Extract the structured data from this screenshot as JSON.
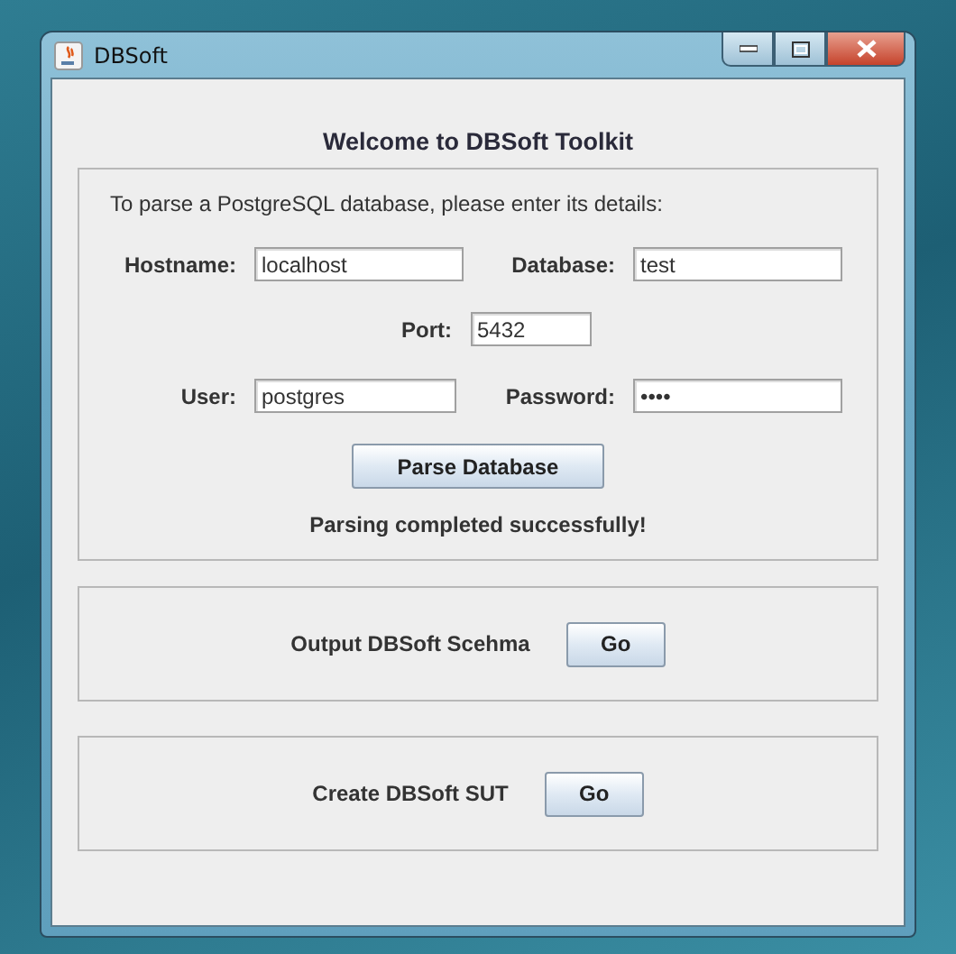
{
  "window": {
    "title": "DBSoft"
  },
  "heading": "Welcome to DBSoft Toolkit",
  "parse_panel": {
    "intro": "To parse a PostgreSQL database, please enter its details:",
    "fields": [
      {
        "label": "Hostname:",
        "value": "localhost"
      },
      {
        "label": "Database:",
        "value": "test"
      },
      {
        "label": "Port:",
        "value": "5432"
      },
      {
        "label": "User:",
        "value": "postgres"
      },
      {
        "label": "Password:",
        "value": "••••"
      }
    ],
    "button": "Parse Database",
    "status": "Parsing completed successfully!"
  },
  "actions": [
    {
      "label": "Output DBSoft Scehma",
      "button": "Go"
    },
    {
      "label": "Create DBSoft SUT",
      "button": "Go"
    }
  ]
}
